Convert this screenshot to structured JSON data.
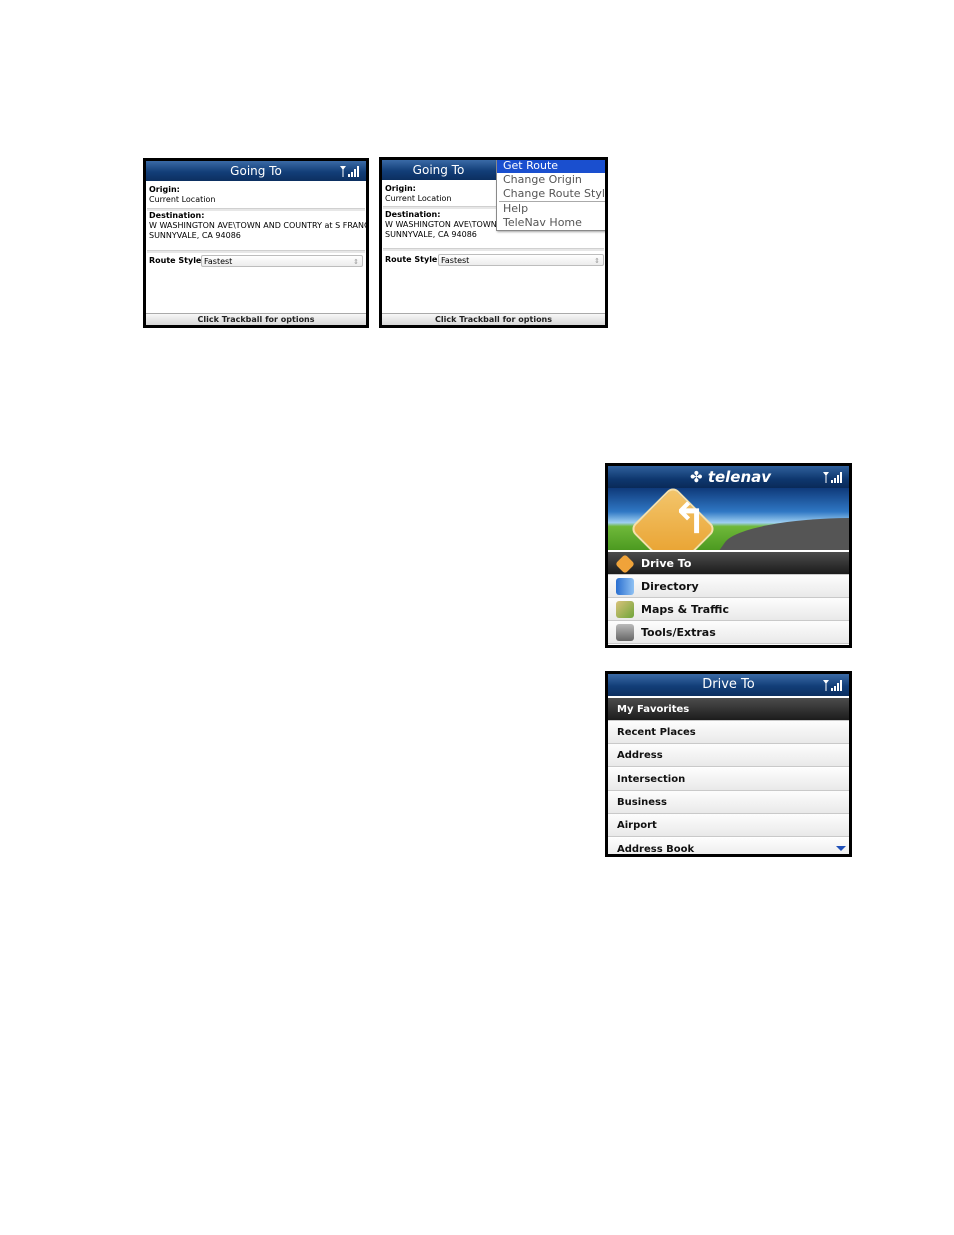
{
  "screen1": {
    "title": "Going To",
    "origin_label": "Origin:",
    "origin_value": "Current Location",
    "destination_label": "Destination:",
    "destination_line1": "W WASHINGTON AVE\\TOWN AND COUNTRY at S FRANCE...",
    "destination_line2": "SUNNYVALE, CA 94086",
    "route_style_label": "Route Style:",
    "route_style_value": "Fastest",
    "status": "Click Trackball for options"
  },
  "screen2": {
    "title": "Going To",
    "origin_label": "Origin:",
    "origin_value": "Current Location",
    "destination_label": "Destination:",
    "destination_line1": "W WASHINGTON AVE\\TOWN A",
    "destination_line2": "SUNNYVALE, CA 94086",
    "route_style_label": "Route Style:",
    "route_style_value": "Fastest",
    "status": "Click Trackball for options",
    "menu": [
      "Get Route",
      "Change Origin",
      "Change Route Style",
      "Help",
      "TeleNav Home"
    ],
    "menu_selected": "Get Route"
  },
  "screen3": {
    "logo": "telenav",
    "items": [
      {
        "label": "Drive To",
        "icon": "drive-to-icon"
      },
      {
        "label": "Directory",
        "icon": "directory-icon"
      },
      {
        "label": "Maps & Traffic",
        "icon": "maps-traffic-icon"
      },
      {
        "label": "Tools/Extras",
        "icon": "tools-extras-icon"
      }
    ],
    "selected": "Drive To"
  },
  "screen4": {
    "title": "Drive To",
    "items": [
      "My Favorites",
      "Recent Places",
      "Address",
      "Intersection",
      "Business",
      "Airport",
      "Address Book"
    ],
    "selected": "My Favorites"
  },
  "colors": {
    "titlebar": "#123e78",
    "menu_highlight": "#1a4fcf",
    "selected_row": "#2a2a2a"
  }
}
